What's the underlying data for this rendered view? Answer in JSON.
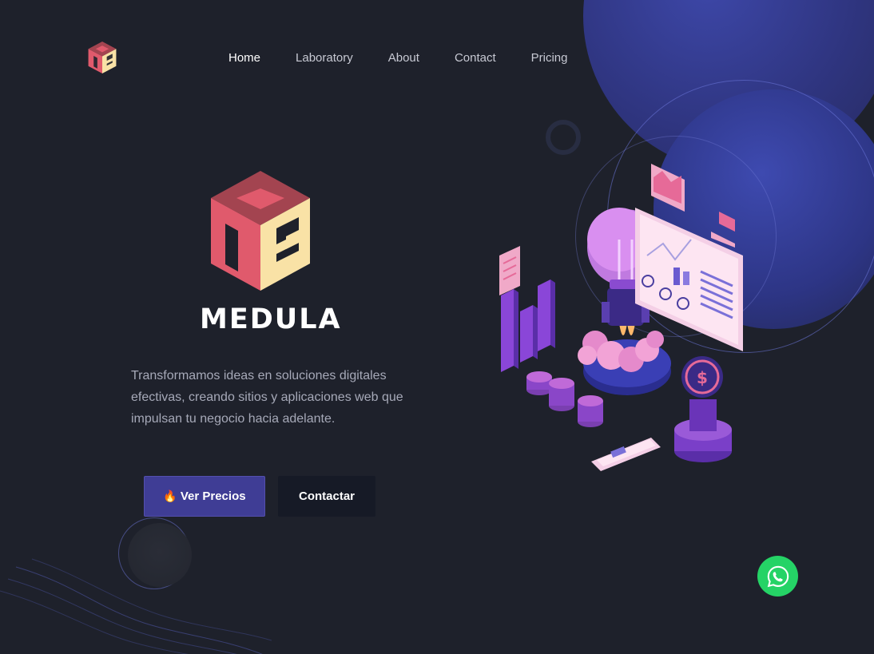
{
  "nav": {
    "items": [
      {
        "label": "Home",
        "active": true
      },
      {
        "label": "Laboratory",
        "active": false
      },
      {
        "label": "About",
        "active": false
      },
      {
        "label": "Contact",
        "active": false
      },
      {
        "label": "Pricing",
        "active": false
      }
    ]
  },
  "hero": {
    "brand": "MEDULA",
    "description": "Transformamos ideas en soluciones digitales efectivas, creando sitios y aplicaciones web que impulsan tu negocio hacia adelante.",
    "primary_button": {
      "icon": "fire-emoji",
      "label": "Ver Precios"
    },
    "secondary_button": {
      "label": "Contactar"
    }
  },
  "colors": {
    "background": "#1e212b",
    "accent": "#3f3d95",
    "logo_top": "#a34450",
    "logo_left": "#e05a6c",
    "logo_right": "#f9e2a6",
    "whatsapp": "#25d366"
  },
  "icons": {
    "logo": "medula-cube-logo",
    "whatsapp": "whatsapp-icon",
    "illustration": "rocket-lightbulb-startup-illustration"
  }
}
